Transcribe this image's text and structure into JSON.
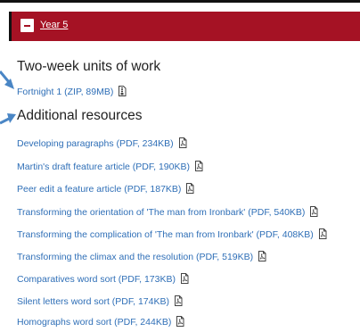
{
  "accordion": {
    "title": "Year 5"
  },
  "sections": {
    "units": {
      "heading": "Two-week units of work",
      "links": [
        {
          "label": "Fortnight 1 (ZIP, 89MB)",
          "icon": "zip-file-icon"
        }
      ]
    },
    "additional": {
      "heading": "Additional resources",
      "links": [
        {
          "label": "Developing paragraphs (PDF, 234KB)",
          "icon": "pdf-file-icon"
        },
        {
          "label": "Martin's draft feature article (PDF, 190KB)",
          "icon": "pdf-file-icon"
        },
        {
          "label": "Peer edit a feature article (PDF, 187KB)",
          "icon": "pdf-file-icon"
        },
        {
          "label": "Transforming the orientation of 'The man from Ironbark' (PDF, 540KB)",
          "icon": "pdf-file-icon"
        },
        {
          "label": "Transforming the complication of 'The man from Ironbark' (PDF, 408KB)",
          "icon": "pdf-file-icon"
        },
        {
          "label": "Transforming the climax and the resolution (PDF, 519KB)",
          "icon": "pdf-file-icon"
        },
        {
          "label": "Comparatives word sort (PDF, 173KB)",
          "icon": "pdf-file-icon"
        },
        {
          "label": "Silent letters word sort (PDF, 174KB)",
          "icon": "pdf-file-icon"
        },
        {
          "label": "Homographs word sort (PDF, 244KB)",
          "icon": "pdf-file-icon"
        }
      ]
    }
  },
  "colors": {
    "header_background": "#a51224",
    "link": "#2f6fb7",
    "annotation_arrow": "#4a86c5"
  }
}
